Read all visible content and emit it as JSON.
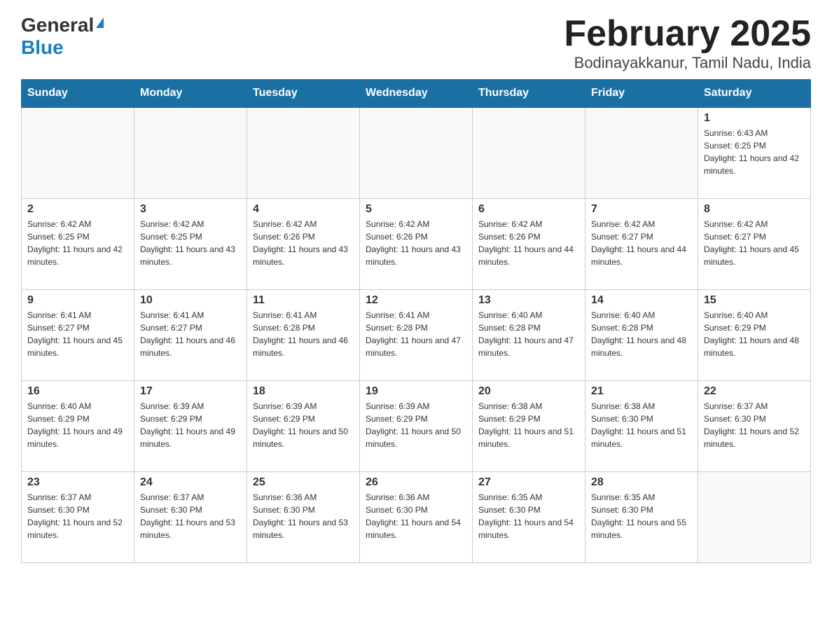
{
  "header": {
    "logo_general": "General",
    "logo_blue": "Blue",
    "title": "February 2025",
    "subtitle": "Bodinayakkanur, Tamil Nadu, India"
  },
  "calendar": {
    "days_of_week": [
      "Sunday",
      "Monday",
      "Tuesday",
      "Wednesday",
      "Thursday",
      "Friday",
      "Saturday"
    ],
    "weeks": [
      [
        {
          "day": "",
          "info": ""
        },
        {
          "day": "",
          "info": ""
        },
        {
          "day": "",
          "info": ""
        },
        {
          "day": "",
          "info": ""
        },
        {
          "day": "",
          "info": ""
        },
        {
          "day": "",
          "info": ""
        },
        {
          "day": "1",
          "info": "Sunrise: 6:43 AM\nSunset: 6:25 PM\nDaylight: 11 hours and 42 minutes."
        }
      ],
      [
        {
          "day": "2",
          "info": "Sunrise: 6:42 AM\nSunset: 6:25 PM\nDaylight: 11 hours and 42 minutes."
        },
        {
          "day": "3",
          "info": "Sunrise: 6:42 AM\nSunset: 6:25 PM\nDaylight: 11 hours and 43 minutes."
        },
        {
          "day": "4",
          "info": "Sunrise: 6:42 AM\nSunset: 6:26 PM\nDaylight: 11 hours and 43 minutes."
        },
        {
          "day": "5",
          "info": "Sunrise: 6:42 AM\nSunset: 6:26 PM\nDaylight: 11 hours and 43 minutes."
        },
        {
          "day": "6",
          "info": "Sunrise: 6:42 AM\nSunset: 6:26 PM\nDaylight: 11 hours and 44 minutes."
        },
        {
          "day": "7",
          "info": "Sunrise: 6:42 AM\nSunset: 6:27 PM\nDaylight: 11 hours and 44 minutes."
        },
        {
          "day": "8",
          "info": "Sunrise: 6:42 AM\nSunset: 6:27 PM\nDaylight: 11 hours and 45 minutes."
        }
      ],
      [
        {
          "day": "9",
          "info": "Sunrise: 6:41 AM\nSunset: 6:27 PM\nDaylight: 11 hours and 45 minutes."
        },
        {
          "day": "10",
          "info": "Sunrise: 6:41 AM\nSunset: 6:27 PM\nDaylight: 11 hours and 46 minutes."
        },
        {
          "day": "11",
          "info": "Sunrise: 6:41 AM\nSunset: 6:28 PM\nDaylight: 11 hours and 46 minutes."
        },
        {
          "day": "12",
          "info": "Sunrise: 6:41 AM\nSunset: 6:28 PM\nDaylight: 11 hours and 47 minutes."
        },
        {
          "day": "13",
          "info": "Sunrise: 6:40 AM\nSunset: 6:28 PM\nDaylight: 11 hours and 47 minutes."
        },
        {
          "day": "14",
          "info": "Sunrise: 6:40 AM\nSunset: 6:28 PM\nDaylight: 11 hours and 48 minutes."
        },
        {
          "day": "15",
          "info": "Sunrise: 6:40 AM\nSunset: 6:29 PM\nDaylight: 11 hours and 48 minutes."
        }
      ],
      [
        {
          "day": "16",
          "info": "Sunrise: 6:40 AM\nSunset: 6:29 PM\nDaylight: 11 hours and 49 minutes."
        },
        {
          "day": "17",
          "info": "Sunrise: 6:39 AM\nSunset: 6:29 PM\nDaylight: 11 hours and 49 minutes."
        },
        {
          "day": "18",
          "info": "Sunrise: 6:39 AM\nSunset: 6:29 PM\nDaylight: 11 hours and 50 minutes."
        },
        {
          "day": "19",
          "info": "Sunrise: 6:39 AM\nSunset: 6:29 PM\nDaylight: 11 hours and 50 minutes."
        },
        {
          "day": "20",
          "info": "Sunrise: 6:38 AM\nSunset: 6:29 PM\nDaylight: 11 hours and 51 minutes."
        },
        {
          "day": "21",
          "info": "Sunrise: 6:38 AM\nSunset: 6:30 PM\nDaylight: 11 hours and 51 minutes."
        },
        {
          "day": "22",
          "info": "Sunrise: 6:37 AM\nSunset: 6:30 PM\nDaylight: 11 hours and 52 minutes."
        }
      ],
      [
        {
          "day": "23",
          "info": "Sunrise: 6:37 AM\nSunset: 6:30 PM\nDaylight: 11 hours and 52 minutes."
        },
        {
          "day": "24",
          "info": "Sunrise: 6:37 AM\nSunset: 6:30 PM\nDaylight: 11 hours and 53 minutes."
        },
        {
          "day": "25",
          "info": "Sunrise: 6:36 AM\nSunset: 6:30 PM\nDaylight: 11 hours and 53 minutes."
        },
        {
          "day": "26",
          "info": "Sunrise: 6:36 AM\nSunset: 6:30 PM\nDaylight: 11 hours and 54 minutes."
        },
        {
          "day": "27",
          "info": "Sunrise: 6:35 AM\nSunset: 6:30 PM\nDaylight: 11 hours and 54 minutes."
        },
        {
          "day": "28",
          "info": "Sunrise: 6:35 AM\nSunset: 6:30 PM\nDaylight: 11 hours and 55 minutes."
        },
        {
          "day": "",
          "info": ""
        }
      ]
    ]
  }
}
